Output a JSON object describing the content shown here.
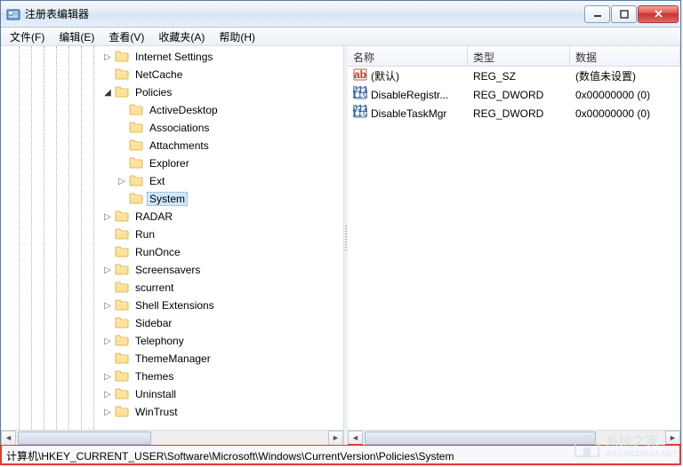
{
  "window": {
    "title": "注册表编辑器"
  },
  "menu": {
    "file": "文件(F)",
    "edit": "编辑(E)",
    "view": "查看(V)",
    "favorites": "收藏夹(A)",
    "help": "帮助(H)"
  },
  "tree": {
    "items": [
      {
        "label": "Internet Settings",
        "expander": "▷",
        "indent": 7
      },
      {
        "label": "NetCache",
        "expander": "",
        "indent": 7
      },
      {
        "label": "Policies",
        "expander": "◢",
        "indent": 7
      },
      {
        "label": "ActiveDesktop",
        "expander": "",
        "indent": 8
      },
      {
        "label": "Associations",
        "expander": "",
        "indent": 8
      },
      {
        "label": "Attachments",
        "expander": "",
        "indent": 8
      },
      {
        "label": "Explorer",
        "expander": "",
        "indent": 8
      },
      {
        "label": "Ext",
        "expander": "▷",
        "indent": 8
      },
      {
        "label": "System",
        "expander": "",
        "indent": 8,
        "selected": true
      },
      {
        "label": "RADAR",
        "expander": "▷",
        "indent": 7
      },
      {
        "label": "Run",
        "expander": "",
        "indent": 7
      },
      {
        "label": "RunOnce",
        "expander": "",
        "indent": 7
      },
      {
        "label": "Screensavers",
        "expander": "▷",
        "indent": 7
      },
      {
        "label": "scurrent",
        "expander": "",
        "indent": 7
      },
      {
        "label": "Shell Extensions",
        "expander": "▷",
        "indent": 7
      },
      {
        "label": "Sidebar",
        "expander": "",
        "indent": 7
      },
      {
        "label": "Telephony",
        "expander": "▷",
        "indent": 7
      },
      {
        "label": "ThemeManager",
        "expander": "",
        "indent": 7
      },
      {
        "label": "Themes",
        "expander": "▷",
        "indent": 7
      },
      {
        "label": "Uninstall",
        "expander": "▷",
        "indent": 7
      },
      {
        "label": "WinTrust",
        "expander": "▷",
        "indent": 7
      }
    ]
  },
  "list": {
    "columns": {
      "name": "名称",
      "type": "类型",
      "data": "数据"
    },
    "rows": [
      {
        "icon": "string",
        "name": "(默认)",
        "type": "REG_SZ",
        "data": "(数值未设置)"
      },
      {
        "icon": "binary",
        "name": "DisableRegistr...",
        "type": "REG_DWORD",
        "data": "0x00000000 (0)"
      },
      {
        "icon": "binary",
        "name": "DisableTaskMgr",
        "type": "REG_DWORD",
        "data": "0x00000000 (0)"
      }
    ]
  },
  "status": {
    "path": "计算机\\HKEY_CURRENT_USER\\Software\\Microsoft\\Windows\\CurrentVersion\\Policies\\System"
  },
  "watermark": {
    "text": "系统之家",
    "sub": "XITONGZHIJIA.NET"
  }
}
